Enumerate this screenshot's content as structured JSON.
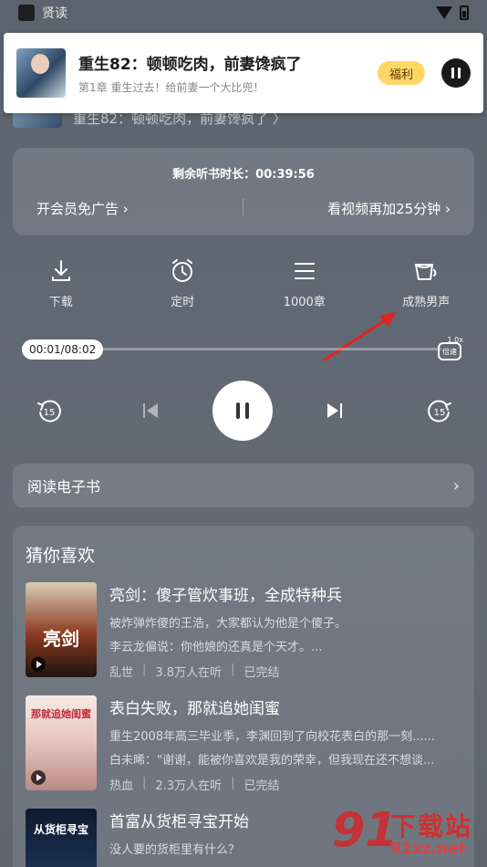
{
  "status_bar": {
    "app_name": "贤读"
  },
  "notification": {
    "title": "重生82：顿顿吃肉，前妻馋疯了",
    "subtitle": "第1章 重生过去！给前妻一个大比兜！",
    "welfare_label": "福利"
  },
  "header_behind": {
    "title": "重生82：顿顿吃肉，前妻馋疯了 〉"
  },
  "listen_card": {
    "remaining_label": "剩余听书时长：00:39:56",
    "vip_label": "开会员免广告 ›",
    "video_label": "看视频再加25分钟 ›"
  },
  "tools": [
    {
      "name": "download",
      "label": "下载",
      "icon": "download-icon"
    },
    {
      "name": "timer",
      "label": "定时",
      "icon": "alarm-clock-icon"
    },
    {
      "name": "chapters",
      "label": "1000章",
      "icon": "list-icon"
    },
    {
      "name": "voice",
      "label": "成熟男声",
      "icon": "voice-cup-icon"
    }
  ],
  "player": {
    "time_display": "00:01/08:02",
    "progress_fraction": 0.02,
    "speed_badge": "1.0x",
    "speed_label": "倍速",
    "rewind_label": "15",
    "forward_label": "15"
  },
  "ebook": {
    "label": "阅读电子书"
  },
  "recommendations": {
    "title": "猜你喜欢",
    "books": [
      {
        "title": "亮剑：傻子管炊事班，全成特种兵",
        "line1": "被炸弹炸傻的王浩，大家都认为他是个傻子。",
        "line2": "李云龙偏说：你他娘的还真是个天才。...",
        "genre": "乱世",
        "listeners": "3.8万人在听",
        "status": "已完结",
        "cover_text": "亮剑"
      },
      {
        "title": "表白失败，那就追她闺蜜",
        "line1": "重生2008年高三毕业季，李渊回到了向校花表白的那一刻......",
        "line2": "白未晞：\"谢谢，能被你喜欢是我的荣幸，但我现在还不想谈...",
        "genre": "热血",
        "listeners": "2.3万人在听",
        "status": "已完结",
        "cover_text": "那就追她闺蜜"
      },
      {
        "title": "首富从货柜寻宝开始",
        "line1": "没人要的货柜里有什么？",
        "line2": "",
        "genre": "",
        "listeners": "",
        "status": "",
        "cover_text": "从货柜寻宝"
      }
    ]
  },
  "watermark": {
    "logo": "91",
    "title": "下载站",
    "url": "91xz.net"
  },
  "colors": {
    "accent_yellow": "#ffd766",
    "annotation_red": "#e0231e"
  }
}
